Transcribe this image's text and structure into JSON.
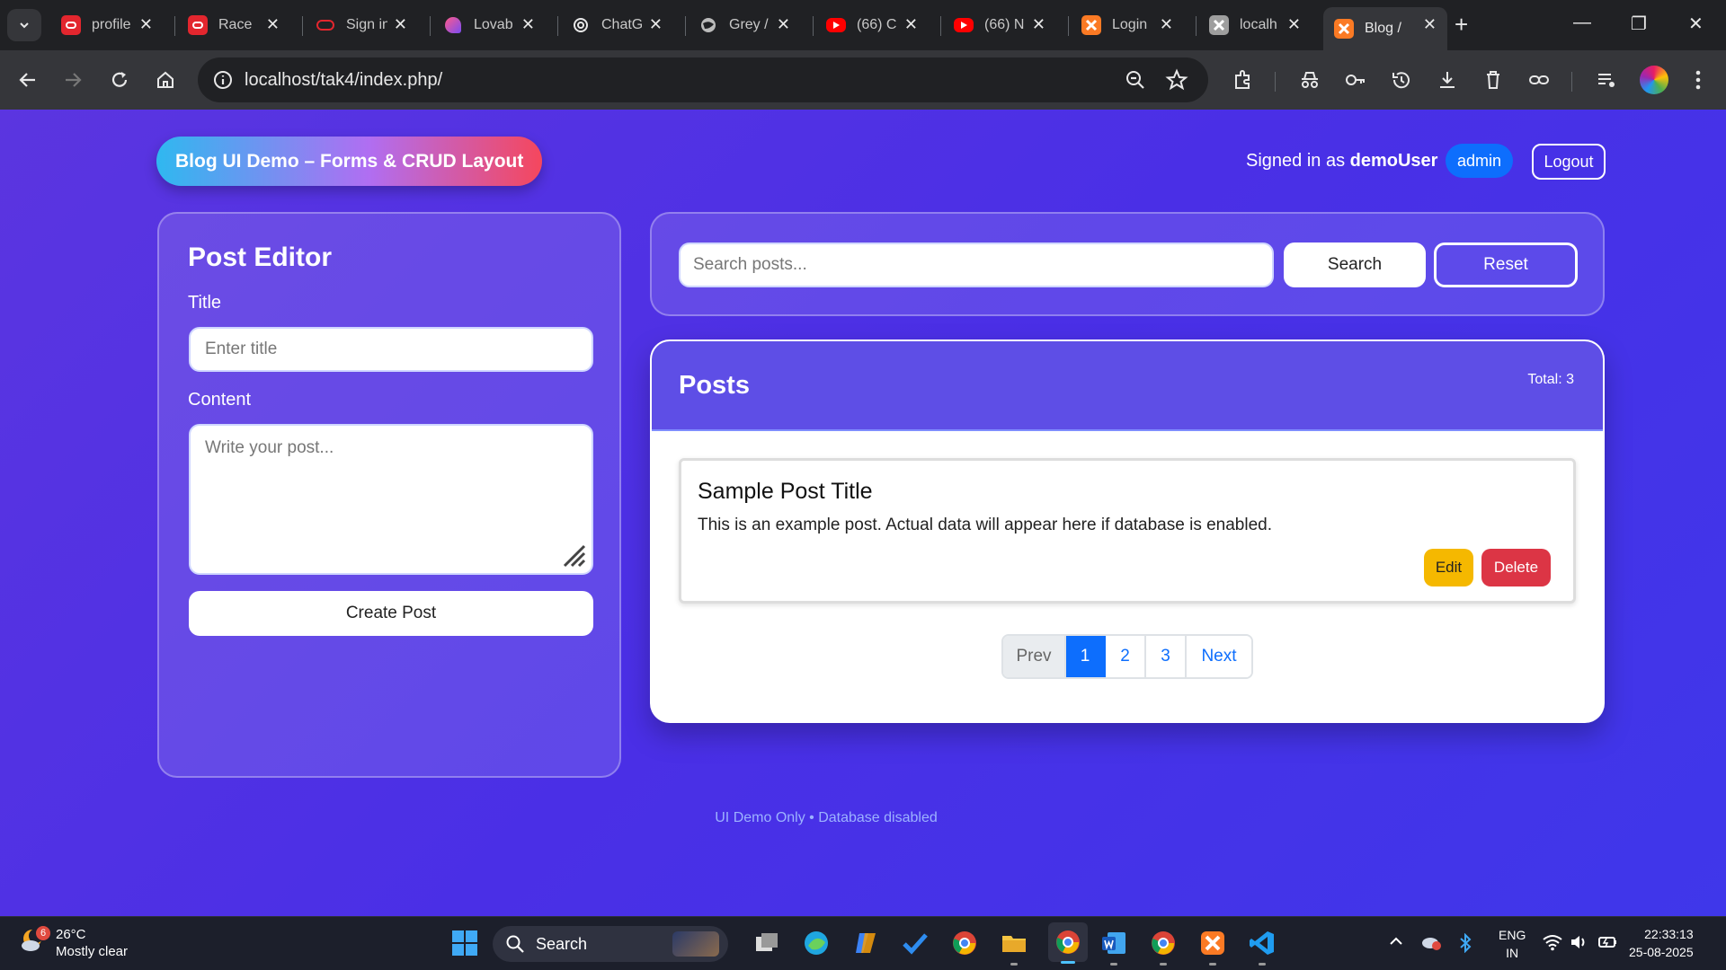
{
  "browser": {
    "tabs": [
      {
        "title": "profile",
        "favicon": "oracle-icon",
        "color": "#e3262e"
      },
      {
        "title": "Race",
        "favicon": "oracle-icon",
        "color": "#e3262e"
      },
      {
        "title": "Sign in",
        "favicon": "oracle-outline-icon",
        "color": "#e3262e"
      },
      {
        "title": "Lovab",
        "favicon": "lovable-icon",
        "color": "#b44cf2"
      },
      {
        "title": "ChatG",
        "favicon": "chatgpt-icon",
        "color": "#ffffff"
      },
      {
        "title": "Grey /",
        "favicon": "globe-icon",
        "color": "#bbbbbb"
      },
      {
        "title": "(66) C",
        "favicon": "youtube-icon",
        "color": "#ff0000"
      },
      {
        "title": "(66) N",
        "favicon": "youtube-icon",
        "color": "#ff0000"
      },
      {
        "title": "Login",
        "favicon": "xampp-icon",
        "color": "#fb7a24"
      },
      {
        "title": "localh",
        "favicon": "xampp-icon",
        "color": "#9e9e9e"
      },
      {
        "title": "Blog /",
        "favicon": "xampp-icon",
        "color": "#fb7a24",
        "active": true
      }
    ],
    "url": "localhost/tak4/index.php/"
  },
  "header": {
    "brand": "Blog UI Demo – Forms & CRUD Layout",
    "signed_prefix": "Signed in as",
    "username": "demoUser",
    "role": "admin",
    "logout": "Logout"
  },
  "editor": {
    "title": "Post Editor",
    "title_label": "Title",
    "title_placeholder": "Enter title",
    "content_label": "Content",
    "content_placeholder": "Write your post...",
    "submit": "Create Post"
  },
  "search": {
    "placeholder": "Search posts...",
    "search_button": "Search",
    "reset_button": "Reset"
  },
  "posts": {
    "heading": "Posts",
    "total": "Total: 3",
    "items": [
      {
        "title": "Sample Post Title",
        "body": "This is an example post. Actual data will appear here if database is enabled.",
        "edit": "Edit",
        "delete": "Delete"
      }
    ],
    "pagination": {
      "prev": "Prev",
      "pages": [
        "1",
        "2",
        "3"
      ],
      "current": "1",
      "next": "Next"
    }
  },
  "footer": "UI Demo Only • Database disabled",
  "taskbar": {
    "temperature": "26°C",
    "weather": "Mostly clear",
    "weather_badge": "6",
    "search": "Search",
    "lang": "ENG",
    "region": "IN",
    "time": "22:33:13",
    "date": "25-08-2025"
  },
  "colors": {
    "page_bg": "#4a2fe6",
    "primary": "#0d6efd",
    "edit": "#f5b800",
    "delete": "#dc3545"
  }
}
